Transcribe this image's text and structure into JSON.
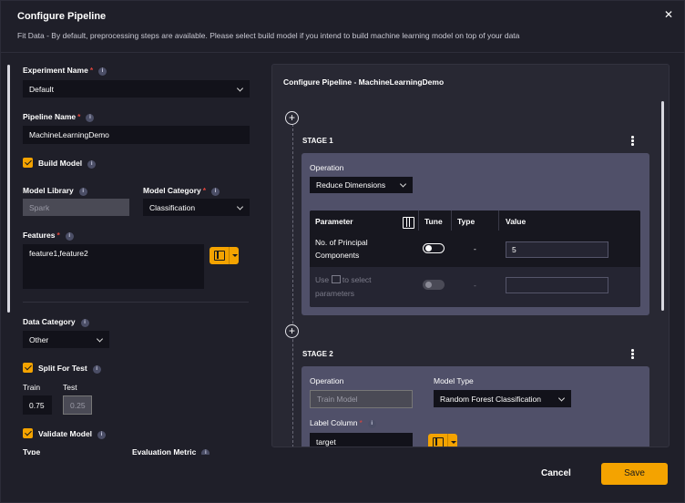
{
  "dialog": {
    "title": "Configure Pipeline",
    "close": "✕",
    "subtitle": "Fit Data - By default, preprocessing steps are available. Please select build model if you intend to build machine learning model on top of your data"
  },
  "left": {
    "experiment_name_label": "Experiment Name",
    "experiment_name_value": "Default",
    "pipeline_name_label": "Pipeline Name",
    "pipeline_name_value": "MachineLearningDemo",
    "build_model_label": "Build Model",
    "model_library_label": "Model Library",
    "model_library_value": "Spark",
    "model_category_label": "Model Category",
    "model_category_value": "Classification",
    "features_label": "Features",
    "features_value": "feature1,feature2",
    "data_category_label": "Data Category",
    "data_category_value": "Other",
    "split_for_test_label": "Split For Test",
    "train_label": "Train",
    "test_label": "Test",
    "train_value": "0.75",
    "test_value": "0.25",
    "validate_model_label": "Validate Model",
    "type_label": "Type",
    "evaluation_metric_label": "Evaluation Metric",
    "required_mark": "*",
    "info_glyph": "i"
  },
  "right": {
    "title": "Configure Pipeline - MachineLearningDemo",
    "plus_glyph": "+",
    "stage1": {
      "label": "STAGE 1",
      "operation_label": "Operation",
      "operation_value": "Reduce Dimensions",
      "table": {
        "headers": [
          "Parameter",
          "Tune",
          "Type",
          "Value"
        ],
        "row1": {
          "parameter": "No. of Principal Components",
          "type": "-",
          "value": "5"
        },
        "row2": {
          "hint_prefix": "Use",
          "hint_suffix": "to select parameters",
          "type": "-",
          "value": ""
        }
      }
    },
    "stage2": {
      "label": "STAGE 2",
      "operation_label": "Operation",
      "operation_value": "Train Model",
      "model_type_label": "Model Type",
      "model_type_value": "Random Forest Classification",
      "label_column_label": "Label Column",
      "label_column_value": "target"
    }
  },
  "footer": {
    "cancel_label": "Cancel",
    "save_label": "Save"
  },
  "colors": {
    "accent": "#f4a300",
    "background": "#1f1f29",
    "card": "#505069",
    "required": "#e0443c"
  }
}
